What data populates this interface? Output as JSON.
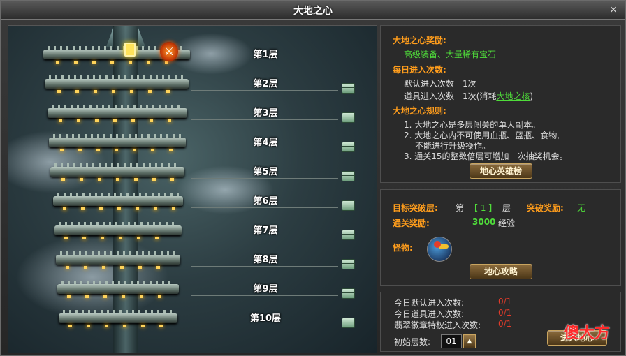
{
  "window": {
    "title": "大地之心",
    "close_symbol": "×"
  },
  "tower": {
    "floors": [
      {
        "label": "第1层",
        "current": true,
        "boss": true
      },
      {
        "label": "第2层"
      },
      {
        "label": "第3层"
      },
      {
        "label": "第4层"
      },
      {
        "label": "第5层"
      },
      {
        "label": "第6层"
      },
      {
        "label": "第7层"
      },
      {
        "label": "第8层"
      },
      {
        "label": "第9层"
      },
      {
        "label": "第10层"
      }
    ],
    "floor_reward_icon": "chest-icon",
    "scroll_icon": "chevron-down-icon"
  },
  "info": {
    "reward_title": "大地之心奖励:",
    "reward_text": "高级装备、大量稀有宝石",
    "daily_title": "每日进入次数:",
    "default_entries": "默认进入次数　1次",
    "item_entries_prefix": "道具进入次数　1次(消耗",
    "item_link": "大地之核",
    "item_entries_suffix": ")",
    "rules_title": "大地之心规则:",
    "rule1": "1. 大地之心是多层闯关的单人副本。",
    "rule2a": "2. 大地之心内不可使用血瓶、蓝瓶、食物,",
    "rule2b": "不能进行升级操作。",
    "rule3": "3. 通关15的整数倍层可增加一次抽奖机会。",
    "ranking_button": "地心英雄榜"
  },
  "target": {
    "label": "目标突破层:",
    "floor_prefix": "第",
    "floor_value": "【 1 】",
    "floor_suffix": "层",
    "break_reward_label": "突破奖励:",
    "break_reward_value": "无",
    "clear_reward_label": "通关奖励:",
    "clear_reward_exp": "3000",
    "clear_reward_unit": "经验",
    "monster_label": "怪物:",
    "monster_icon": "monster-portrait",
    "guide_button": "地心攻略"
  },
  "entry": {
    "default_label": "今日默认进入次数:",
    "default_value": "0/1",
    "item_label": "今日道具进入次数:",
    "item_value": "0/1",
    "emerald_label": "翡翠徽章特权进入次数:",
    "emerald_value": "0/1",
    "start_floor_label": "初始层数:",
    "start_floor_value": "01",
    "enter_button": "进入地心"
  },
  "colors": {
    "accent_orange": "#ff9d1c",
    "text_green": "#4fdc3a",
    "count_red": "#e23b2a"
  },
  "watermark": "傻大方"
}
